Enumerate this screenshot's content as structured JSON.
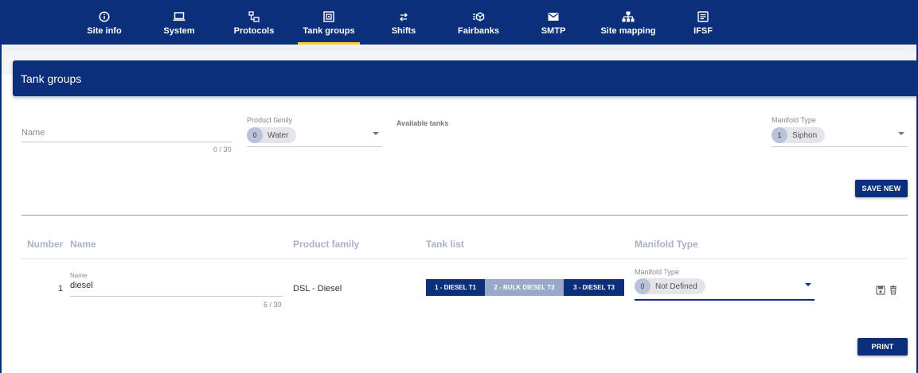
{
  "nav": {
    "items": [
      {
        "label": "Site info",
        "icon": "info-icon"
      },
      {
        "label": "System",
        "icon": "laptop-icon"
      },
      {
        "label": "Protocols",
        "icon": "network-icon"
      },
      {
        "label": "Tank groups",
        "icon": "tank-group-icon",
        "active": true
      },
      {
        "label": "Shifts",
        "icon": "swap-icon"
      },
      {
        "label": "Fairbanks",
        "icon": "cube-list-icon"
      },
      {
        "label": "SMTP",
        "icon": "envelope-icon"
      },
      {
        "label": "Site mapping",
        "icon": "sitemap-icon"
      },
      {
        "label": "IFSF",
        "icon": "document-icon"
      }
    ]
  },
  "header": {
    "title": "Tank groups"
  },
  "form": {
    "name_placeholder": "Name",
    "name_counter": "0 / 30",
    "product_family_label": "Product family",
    "product_family_count": "0",
    "product_family_value": "Water",
    "available_tanks_label": "Available tanks",
    "manifold_label": "Manifold Type",
    "manifold_count": "1",
    "manifold_value": "Siphon",
    "save_button": "SAVE NEW"
  },
  "table": {
    "headers": {
      "number": "Number",
      "name": "Name",
      "product_family": "Product family",
      "tank_list": "Tank list",
      "manifold": "Manifold Type"
    },
    "rows": [
      {
        "number": "1",
        "name_label": "Name",
        "name": "diesel",
        "name_counter": "6 / 30",
        "product_family": "DSL - Diesel",
        "tanks": [
          "1 - DIESEL T1",
          "2 - BULK DIESEL T2",
          "3 - DIESEL T3"
        ],
        "manifold_label": "Manifold Type",
        "manifold_count": "0",
        "manifold_value": "Not Defined"
      }
    ]
  },
  "print_button": "PRINT",
  "colors": {
    "primary": "#0b2f7a",
    "accent": "#f2d03b",
    "tank_inactive": "#98a8c8"
  }
}
